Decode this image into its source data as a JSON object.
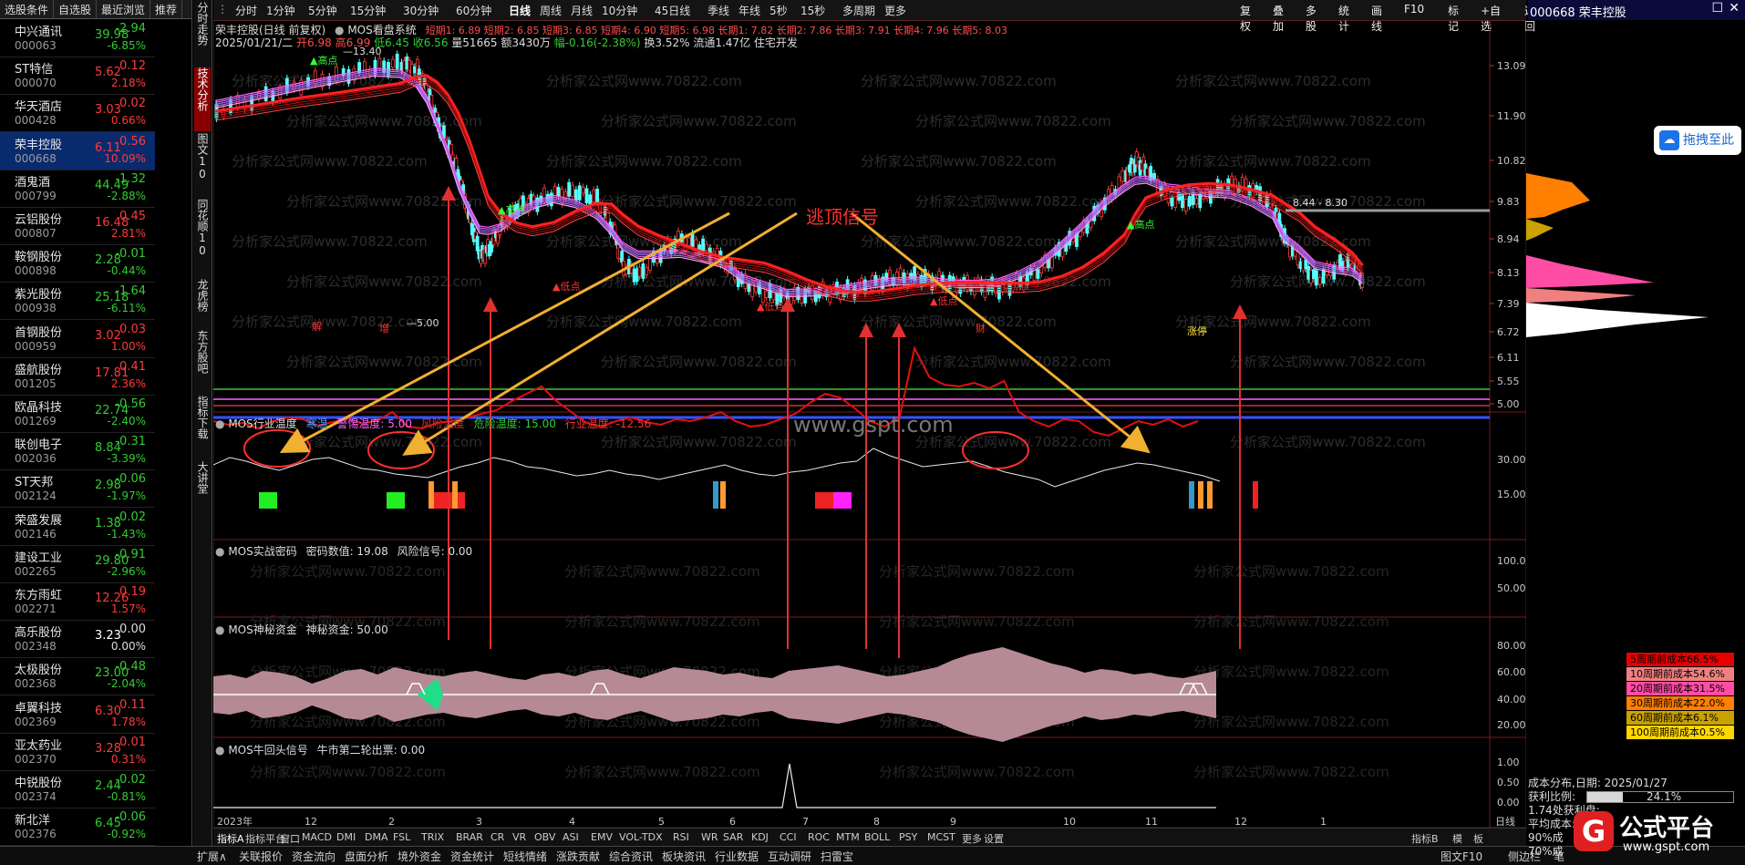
{
  "watchlist": {
    "tabs": [
      "选股条件",
      "自选股",
      "最近浏览",
      "推荐"
    ],
    "rows": [
      {
        "name": "中兴通讯",
        "code": "000063",
        "price": "39.98",
        "chg": "-2.94",
        "pct": "-6.85%",
        "dir": "down"
      },
      {
        "name": "ST特信",
        "code": "000070",
        "price": "5.62",
        "chg": "0.12",
        "pct": "2.18%",
        "dir": "up"
      },
      {
        "name": "华天酒店",
        "code": "000428",
        "price": "3.03",
        "chg": "0.02",
        "pct": "0.66%",
        "dir": "up"
      },
      {
        "name": "荣丰控股",
        "code": "000668",
        "price": "6.11",
        "chg": "0.56",
        "pct": "10.09%",
        "dir": "up"
      },
      {
        "name": "酒鬼酒",
        "code": "000799",
        "price": "44.49",
        "chg": "-1.32",
        "pct": "-2.88%",
        "dir": "down"
      },
      {
        "name": "云铝股份",
        "code": "000807",
        "price": "16.48",
        "chg": "0.45",
        "pct": "2.81%",
        "dir": "up"
      },
      {
        "name": "鞍钢股份",
        "code": "000898",
        "price": "2.28",
        "chg": "-0.01",
        "pct": "-0.44%",
        "dir": "down"
      },
      {
        "name": "紫光股份",
        "code": "000938",
        "price": "25.18",
        "chg": "-1.64",
        "pct": "-6.11%",
        "dir": "down"
      },
      {
        "name": "首钢股份",
        "code": "000959",
        "price": "3.02",
        "chg": "0.03",
        "pct": "1.00%",
        "dir": "up"
      },
      {
        "name": "盛航股份",
        "code": "001205",
        "price": "17.81",
        "chg": "0.41",
        "pct": "2.36%",
        "dir": "up"
      },
      {
        "name": "欧晶科技",
        "code": "001269",
        "price": "22.74",
        "chg": "-0.56",
        "pct": "-2.40%",
        "dir": "down"
      },
      {
        "name": "联创电子",
        "code": "002036",
        "price": "8.84",
        "chg": "-0.31",
        "pct": "-3.39%",
        "dir": "down"
      },
      {
        "name": "ST天邦",
        "code": "002124",
        "price": "2.98",
        "chg": "-0.06",
        "pct": "-1.97%",
        "dir": "down"
      },
      {
        "name": "荣盛发展",
        "code": "002146",
        "price": "1.38",
        "chg": "-0.02",
        "pct": "-1.43%",
        "dir": "down"
      },
      {
        "name": "建设工业",
        "code": "002265",
        "price": "29.80",
        "chg": "-0.91",
        "pct": "-2.96%",
        "dir": "down"
      },
      {
        "name": "东方雨虹",
        "code": "002271",
        "price": "12.26",
        "chg": "0.19",
        "pct": "1.57%",
        "dir": "up"
      },
      {
        "name": "高乐股份",
        "code": "002348",
        "price": "3.23",
        "chg": "0.00",
        "pct": "0.00%",
        "dir": "flat"
      },
      {
        "name": "太极股份",
        "code": "002368",
        "price": "23.00",
        "chg": "-0.48",
        "pct": "-2.04%",
        "dir": "down"
      },
      {
        "name": "卓翼科技",
        "code": "002369",
        "price": "6.30",
        "chg": "0.11",
        "pct": "1.78%",
        "dir": "up"
      },
      {
        "name": "亚太药业",
        "code": "002370",
        "price": "3.28",
        "chg": "0.01",
        "pct": "0.31%",
        "dir": "up"
      },
      {
        "name": "中锐股份",
        "code": "002374",
        "price": "2.44",
        "chg": "-0.02",
        "pct": "-0.81%",
        "dir": "down"
      },
      {
        "name": "新北洋",
        "code": "002376",
        "price": "6.45",
        "chg": "-0.06",
        "pct": "-0.92%",
        "dir": "down"
      }
    ]
  },
  "vtabs": [
    "分时走势",
    "技术分析",
    "图文10",
    "同花顺10",
    "龙虎榜",
    "东方股吧",
    "指标下载",
    "大讲堂"
  ],
  "periods": [
    "分时",
    "1分钟",
    "5分钟",
    "15分钟",
    "30分钟",
    "60分钟",
    "日线",
    "周线",
    "月线",
    "10分钟",
    "45日线",
    "季线",
    "年线",
    "5秒",
    "15秒",
    "多周期",
    "更多"
  ],
  "right_toolbar": [
    "复权",
    "叠加",
    "多股",
    "统计",
    "画线",
    "F10",
    "标记",
    "+自选",
    "返回"
  ],
  "stock_header": "000668 荣丰控股",
  "info_line1": {
    "name": "荣丰控股(日线 前复权)",
    "indicator": "MOS看盘系统",
    "params": "短期1: 6.89  短期2: 6.85  短期3: 6.85  短期4: 6.90  短期5: 6.98  长期1: 7.82  长期2: 7.86  长期3: 7.91  长期4: 7.96  长期5: 8.03"
  },
  "info_line2": {
    "date": "2025/01/21/二",
    "open": "开6.98",
    "high": "高6.99",
    "low": "低6.45",
    "close": "收6.56",
    "vol": "量51665",
    "amt": "额3430万",
    "chg": "幅-0.16(-2.38%)",
    "turn": "换3.52%",
    "float": "流通1.47亿",
    "type": "住宅开发"
  },
  "main_yticks": [
    "13.09",
    "11.90",
    "10.82",
    "9.83",
    "8.94",
    "8.13",
    "7.39",
    "6.72",
    "6.11",
    "5.55",
    "5.00"
  ],
  "annotations": {
    "escape_signal": "逃顶信号",
    "peak": "13.40",
    "bottom": "5.00",
    "right_line": "8.44 - 8.30",
    "lows": [
      "低点",
      "低点",
      "低点"
    ],
    "highs": [
      "高点",
      "高点",
      "高点"
    ],
    "labels_red": [
      "解",
      "增",
      "财",
      "涨停"
    ]
  },
  "drag_button": "拖拽至此",
  "panel1": {
    "title": "MOS行业温度",
    "items": [
      "寒温",
      "警惕温度: 5.00",
      "风险温度",
      "危险温度: 15.00",
      "行业温度: -12.56"
    ],
    "yticks": [
      "30.00",
      "15.00"
    ]
  },
  "panel2": {
    "title": "MOS实战密码",
    "items": [
      "密码数值: 19.08",
      "风险信号: 0.00"
    ],
    "yticks": [
      "100.0",
      "50.00"
    ]
  },
  "panel3": {
    "title": "MOS神秘资金",
    "items": [
      "神秘资金: 50.00"
    ],
    "yticks": [
      "80.00",
      "60.00",
      "40.00",
      "20.00"
    ]
  },
  "panel4": {
    "title": "MOS牛回头信号",
    "items": [
      "牛市第二轮出票: 0.00"
    ],
    "yticks": [
      "1.00",
      "0.50",
      "0.00"
    ]
  },
  "watermark_center": "www.gspt.com",
  "watermark_rep": "分析家公式网www.70822.com",
  "x_axis": {
    "year": "2023年",
    "months": [
      "12",
      "2",
      "3",
      "4",
      "5",
      "6",
      "7",
      "8",
      "9",
      "10",
      "11",
      "12",
      "1"
    ],
    "right": "日线"
  },
  "indicator_tabs": [
    "指标A",
    "指标平台",
    "窗口",
    "MACD",
    "DMI",
    "DMA",
    "FSL",
    "TRIX",
    "BRAR",
    "CR",
    "VR",
    "OBV",
    "ASI",
    "EMV",
    "VOL-TDX",
    "RSI",
    "WR",
    "SAR",
    "KDJ",
    "CCI",
    "ROC",
    "MTM",
    "BOLL",
    "PSY",
    "MCST",
    "更多",
    "设置"
  ],
  "indicator_tabs_right": [
    "指标B",
    "模",
    "板"
  ],
  "bottom_bar": [
    "扩展∧",
    "关联报价",
    "资金流向",
    "盘面分析",
    "境外资金",
    "资金统计",
    "短线情绪",
    "涨跌贡献",
    "综合资讯",
    "板块资讯",
    "行业数据",
    "互动调研",
    "扫雷宝"
  ],
  "bottom_right": [
    "图文F10",
    "侧边栏",
    "笔"
  ],
  "cost": {
    "periods": [
      {
        "label": "5周期前成本66.5%",
        "color": "#e60000"
      },
      {
        "label": "10周期前成本54.6%",
        "color": "#f08080"
      },
      {
        "label": "20周期前成本31.5%",
        "color": "#ff4da6"
      },
      {
        "label": "30周期前成本22.0%",
        "color": "#ff7f00"
      },
      {
        "label": "60周期前成本6.1%",
        "color": "#c9a100"
      },
      {
        "label": "100周期前成本0.5%",
        "color": "#ffd700"
      }
    ],
    "date_label": "成本分布,日期: 2025/01/27",
    "profit_label": "获利比例:",
    "profit_value": "24.1%",
    "profit_fraction": 0.241,
    "profit_price": "1.74处获利盘:",
    "avg": "平均成本: 6.84元",
    "p90": "90%成",
    "p70": "70%成"
  },
  "logo": {
    "name": "公式平台",
    "url": "www.gspt.com",
    "glyph": "G"
  }
}
